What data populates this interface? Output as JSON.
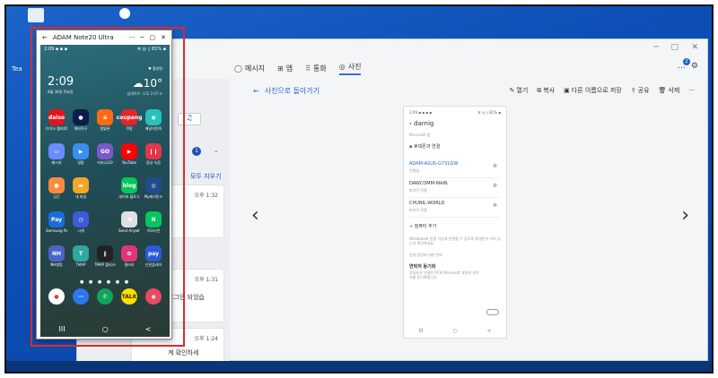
{
  "desktop": {
    "icons": [
      "",
      "",
      "Tea",
      "",
      "",
      "",
      ""
    ]
  },
  "phone_link": {
    "nav": {
      "messages": "메시지",
      "apps": "앱",
      "calls": "통화",
      "photos": "사진"
    },
    "badge_count": "2",
    "left": {
      "count": "1",
      "clear_all": "모두 지우기",
      "cards": [
        {
          "time": "오후 1:32",
          "text": ""
        },
        {
          "time": "오후 1:31",
          "text": "로그인 되었습"
        },
        {
          "time": "오후 1:24",
          "text": "계 확인하세"
        }
      ]
    },
    "viewer": {
      "back": "사진으로 돌아가기",
      "toolbar": {
        "open": "열기",
        "copy": "복사",
        "save_as": "다른 이름으로 저장",
        "share": "공유",
        "delete": "삭제",
        "more": "···"
      },
      "shot": {
        "status": "2:09 ▪ ▪ ▪ ▪",
        "status_right": "✲ ◎ ▯ 81% ▪",
        "account": "darnig",
        "section_ms": "Microsoft 앱",
        "phone_link_row": "휴대폰과 연결",
        "devices": [
          {
            "name": "ADAM-ASUS-G731GW",
            "sub": "연결됨"
          },
          {
            "name": "DAWCOMM-MAIN",
            "sub": "마지막 연결"
          },
          {
            "name": "CHUNIL-WORLD",
            "sub": "마지막 연결"
          }
        ],
        "add_pc": "컴퓨터 추가",
        "note": "Windows와 연결 기능에 연결할 수 있도록 휴대폰이 켜져 있는지 확인하세요.",
        "section_other": "연결 설정에 대한 정보",
        "sync_title": "연락처 동기화",
        "sync_desc": "휴대폰과 연결된 PC와 Microsoft 계정에 연락처를 동기화합니다"
      }
    }
  },
  "phone_window": {
    "title": "ADAM Note20 Ultra",
    "status_left": "2:09 ▪ ▪ ▪",
    "status_right": "✲ ◎ ▯ 81% ▪",
    "clock": "2:09",
    "date": "9월 30일 목요일",
    "weather_loc": "♥ 중부면",
    "weather_temp": "10°",
    "weather_upd": "업데이트: 오후 2:07 ⟳",
    "apps": [
      {
        "label": "다이소 헬퍼(D)",
        "glyph": "daiso",
        "color": "#e3141e"
      },
      {
        "label": "해외직구",
        "glyph": "●",
        "color": "#0d1b4d"
      },
      {
        "label": "알뜰폰",
        "glyph": "a",
        "color": "#ff6a13"
      },
      {
        "label": "쿠팡",
        "glyph": "coupang",
        "color": "#e52528"
      },
      {
        "label": "배달의민족",
        "glyph": "◉",
        "color": "#2ac1bc"
      },
      {
        "label": "메시지",
        "glyph": "▭",
        "color": "#6b8cff"
      },
      {
        "label": "알람",
        "glyph": "▶",
        "color": "#3b8ef2"
      },
      {
        "label": "티머니GO",
        "glyph": "GO",
        "color": "#7b57c8"
      },
      {
        "label": "YouTube",
        "glyph": "▶",
        "color": "#ff0000"
      },
      {
        "label": "음성 녹음",
        "glyph": "❙❙",
        "color": "#e5364b"
      },
      {
        "label": "당근",
        "glyph": "●",
        "color": "#ff8a3d"
      },
      {
        "label": "내 파일",
        "glyph": "▬",
        "color": "#f5a623"
      },
      {
        "label": "",
        "glyph": "",
        "color": "transparent"
      },
      {
        "label": "네이버 블로그",
        "glyph": "blog",
        "color": "#03c75a"
      },
      {
        "label": "My제리빈스",
        "glyph": "◎",
        "color": "#1d4d8a"
      },
      {
        "label": "Samsung Pay",
        "glyph": "Pay",
        "color": "#1a6cdb"
      },
      {
        "label": "시계",
        "glyph": "◷",
        "color": "#3d5bd9"
      },
      {
        "label": "",
        "glyph": "",
        "color": "transparent"
      },
      {
        "label": "Send Anywhere",
        "glyph": "◥",
        "color": "#e0e0e0"
      },
      {
        "label": "이모티콘",
        "glyph": "N",
        "color": "#03c75a"
      },
      {
        "label": "NH뱅킹",
        "glyph": "NH",
        "color": "#4b64c9"
      },
      {
        "label": "TMAP",
        "glyph": "T",
        "color": "#2fa8a0"
      },
      {
        "label": "TMAP 플러스마크",
        "glyph": "∥",
        "color": "#222"
      },
      {
        "label": "갤러리",
        "glyph": "✿",
        "color": "#e0357a"
      },
      {
        "label": "신한플레이",
        "glyph": "pay",
        "color": "#2a5bd7"
      }
    ],
    "dock": [
      "●",
      "⋯",
      "✆",
      "TALK",
      "◉"
    ],
    "dock_colors": [
      "#ffffff",
      "#2b78f0",
      "#10a35c",
      "#ffe000",
      "#e84a5f"
    ],
    "navbar": [
      "III",
      "○",
      "<"
    ]
  }
}
